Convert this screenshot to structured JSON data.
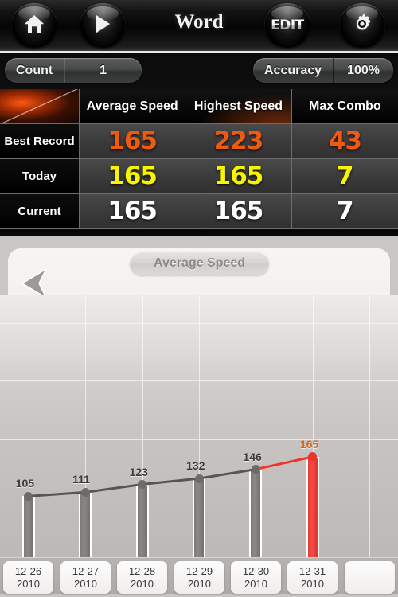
{
  "topbar": {
    "title": "Word",
    "buttons": [
      {
        "name": "home-button",
        "icon": "home-icon",
        "label": ""
      },
      {
        "name": "play-button",
        "icon": "play-icon",
        "label": ""
      },
      {
        "name": "edit-button",
        "icon": "edit-text-icon",
        "label": "EDIT"
      },
      {
        "name": "settings-button",
        "icon": "gear-icon",
        "label": ""
      }
    ]
  },
  "stats": {
    "count": {
      "label": "Count",
      "value": "1"
    },
    "accuracy": {
      "label": "Accuracy",
      "value": "100%"
    },
    "table": {
      "columns": [
        "",
        "Average Speed",
        "Highest Speed",
        "Max Combo"
      ],
      "rows": [
        {
          "label": "Best Record",
          "color": "#ef5a10",
          "values": [
            "165",
            "223",
            "43"
          ]
        },
        {
          "label": "Today",
          "color": "#f7f500",
          "values": [
            "165",
            "165",
            "7"
          ]
        },
        {
          "label": "Current",
          "color": "#ffffff",
          "values": [
            "165",
            "165",
            "7"
          ]
        }
      ]
    }
  },
  "chart_panel": {
    "back_label": "back-arrow",
    "title_pill": "Average Speed"
  },
  "chart_data": {
    "type": "bar",
    "title": "Average Speed",
    "xlabel": "",
    "ylabel": "",
    "categories": [
      "12-26\n2010",
      "12-27\n2010",
      "12-28\n2010",
      "12-29\n2010",
      "12-30\n2010",
      "12-31\n2010",
      ""
    ],
    "tick_labels": [
      {
        "date": "12-26",
        "year": "2010"
      },
      {
        "date": "12-27",
        "year": "2010"
      },
      {
        "date": "12-28",
        "year": "2010"
      },
      {
        "date": "12-29",
        "year": "2010"
      },
      {
        "date": "12-30",
        "year": "2010"
      },
      {
        "date": "12-31",
        "year": "2010"
      },
      {
        "date": "",
        "year": ""
      }
    ],
    "values": [
      105,
      111,
      123,
      132,
      146,
      165,
      null
    ],
    "point_labels": [
      "105",
      "111",
      "123",
      "132",
      "146",
      "165",
      ""
    ],
    "highlight_index": 5,
    "colors": {
      "bar": "#7d7b7a",
      "highlight_bar": "#ea3b34",
      "line": "#585655",
      "highlight_line": "#f0332b",
      "label": "#3d3b3a",
      "highlight_label": "#d2681a"
    },
    "ylim": [
      0,
      400
    ],
    "grid": true,
    "legend": "none",
    "overlay_line": true
  },
  "palette": {
    "accent_orange": "#ef5a10",
    "accent_yellow": "#f7f500",
    "accent_red": "#ea3b34",
    "panel_dark": "#0b0b0b",
    "chart_bg": "#c6c3c1"
  }
}
